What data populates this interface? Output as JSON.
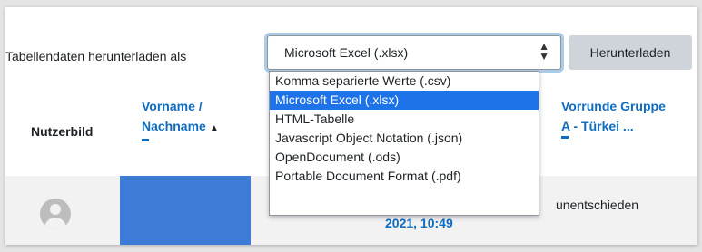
{
  "toolbar": {
    "label": "Tabellendaten herunterladen als",
    "selected_format": "Microsoft Excel (.xlsx)",
    "download_button": "Herunterladen"
  },
  "table": {
    "headers": {
      "user_picture": "Nutzerbild",
      "first_name": "Vorname",
      "last_name": "Nachname",
      "name_separator": " /",
      "group_line1": "Vorrunde Gruppe",
      "group_line2": "A - Türkei ..."
    },
    "row": {
      "date": "2021, 10:49",
      "result": "unentschieden"
    }
  },
  "dropdown": {
    "options": [
      "Komma separierte Werte (.csv)",
      "Microsoft Excel (.xlsx)",
      "HTML-Tabelle",
      "Javascript Object Notation (.json)",
      "OpenDocument (.ods)",
      "Portable Document Format (.pdf)"
    ],
    "selected_index": 1
  },
  "colors": {
    "link": "#0f6cbf",
    "highlight": "#1e73e8",
    "button": "#ced4da"
  }
}
